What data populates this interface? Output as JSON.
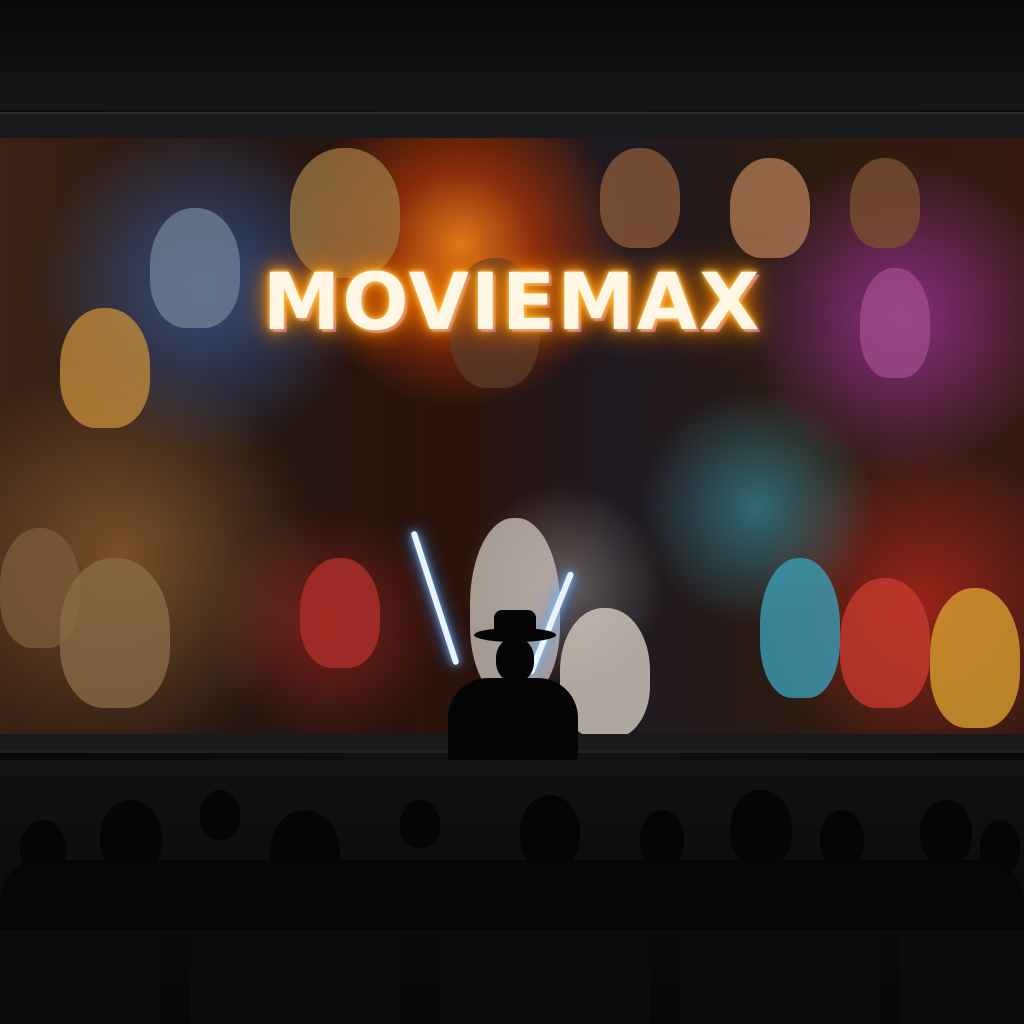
{
  "screen": {
    "title": "MOVIEMAX"
  },
  "colors": {
    "title_glow": "#ff8a00",
    "title_fill": "#fff7e6",
    "background": "#0b0b0c"
  }
}
